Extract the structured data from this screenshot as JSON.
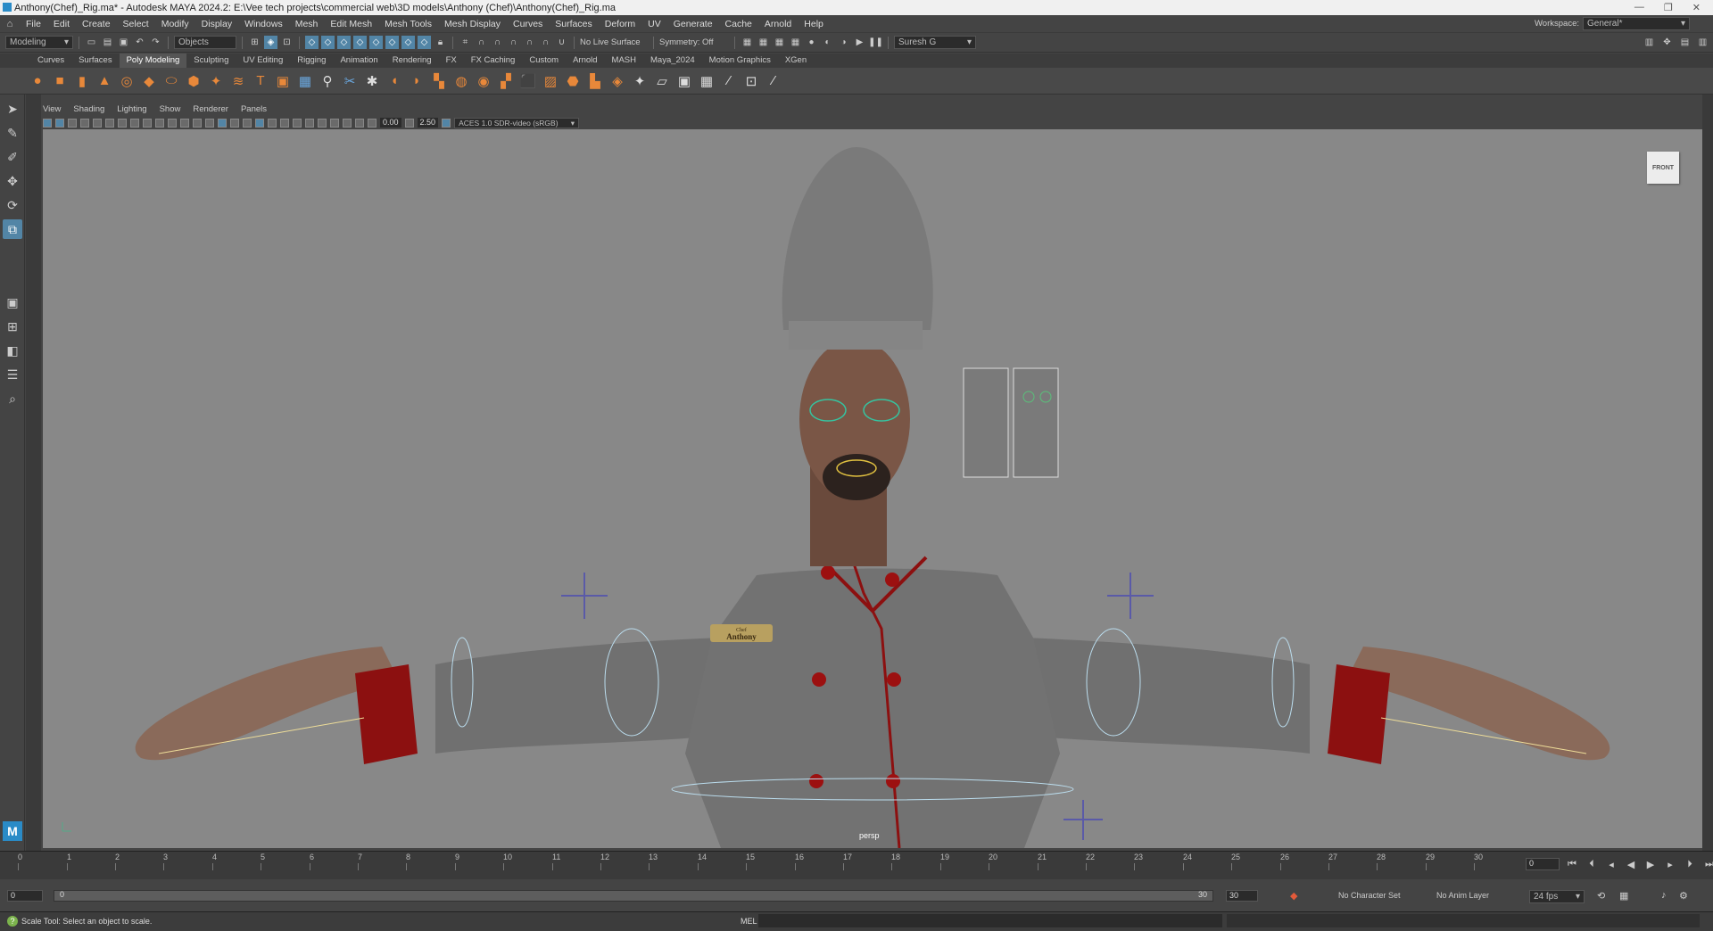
{
  "title_bar": {
    "text": "Anthony(Chef)_Rig.ma* - Autodesk MAYA 2024.2: E:\\Vee tech projects\\commercial web\\3D models\\Anthony (Chef)\\Anthony(Chef)_Rig.ma"
  },
  "menu": [
    "File",
    "Edit",
    "Create",
    "Select",
    "Modify",
    "Display",
    "Windows",
    "Mesh",
    "Edit Mesh",
    "Mesh Tools",
    "Mesh Display",
    "Curves",
    "Surfaces",
    "Deform",
    "UV",
    "Generate",
    "Cache",
    "Arnold",
    "Help"
  ],
  "workspace": {
    "label": "Workspace:",
    "value": "General*"
  },
  "status_line": {
    "menu_set": "Modeling",
    "selection_mode": "Objects",
    "live_surface": "No Live Surface",
    "symmetry": "Symmetry: Off",
    "user": "Suresh G"
  },
  "shelf_tabs": [
    "Curves",
    "Surfaces",
    "Poly Modeling",
    "Sculpting",
    "UV Editing",
    "Rigging",
    "Animation",
    "Rendering",
    "FX",
    "FX Caching",
    "Custom",
    "Arnold",
    "MASH",
    "Maya_2024",
    "Motion Graphics",
    "XGen"
  ],
  "active_shelf_tab": "Poly Modeling",
  "panel_menu": [
    "View",
    "Shading",
    "Lighting",
    "Show",
    "Renderer",
    "Panels"
  ],
  "panel_toolbar": {
    "exposure": "0.00",
    "gamma": "2.50",
    "color_space": "ACES 1.0 SDR-video (sRGB)"
  },
  "viewport": {
    "camera": "persp",
    "view_cube": "FRONT",
    "name_tag_small": "Chef",
    "name_tag": "Anthony"
  },
  "timeline": {
    "ticks": [
      "1",
      "2",
      "3",
      "4",
      "5",
      "6",
      "7",
      "8",
      "9",
      "10",
      "11",
      "12",
      "13",
      "14",
      "15",
      "16",
      "17",
      "18",
      "19",
      "20",
      "21",
      "22",
      "23",
      "24",
      "25",
      "26",
      "27",
      "28",
      "29",
      "30"
    ],
    "current_frame": "0",
    "current_frame_marker": "0"
  },
  "range": {
    "start": "0",
    "inner_start": "0",
    "inner_end": "30",
    "end": "30",
    "character_set": "No Character Set",
    "anim_layer": "No Anim Layer",
    "fps": "24 fps"
  },
  "command_line": {
    "help_text": "Scale Tool: Select an object to scale.",
    "lang": "MEL"
  },
  "icons": [
    "search-icon",
    "gear-icon",
    "select-tool-icon",
    "lasso-icon",
    "paint-icon",
    "move-icon",
    "rotate-icon",
    "scale-icon",
    "play-icon",
    "stop-icon"
  ]
}
